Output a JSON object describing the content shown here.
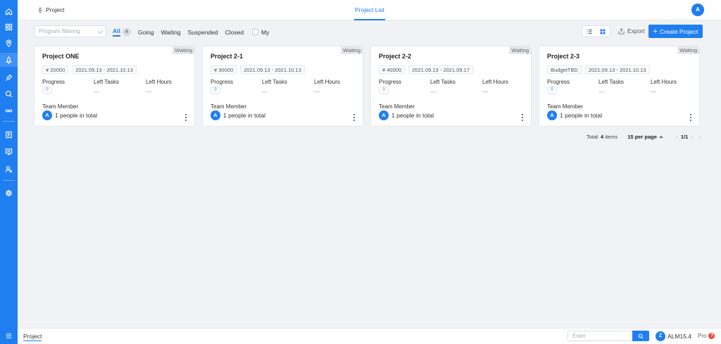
{
  "sidebar": {
    "items": [
      {
        "icon": "home-icon"
      },
      {
        "icon": "dashboard-grid-icon"
      },
      {
        "icon": "location-pin-icon"
      },
      {
        "icon": "rocket-icon",
        "active": true
      },
      {
        "icon": "pin-icon"
      },
      {
        "icon": "search-icon"
      },
      {
        "icon": "infinity-icon"
      },
      {
        "icon": "list-document-icon"
      },
      {
        "icon": "monitor-icon"
      },
      {
        "icon": "user-settings-icon"
      },
      {
        "icon": "gear-icon"
      }
    ],
    "bottom_icon": "menu-icon"
  },
  "header": {
    "breadcrumb": "Project",
    "tab": "Project List",
    "avatar": "A"
  },
  "filters": {
    "search_placeholder": "Program filtering",
    "tabs": [
      {
        "label": "All",
        "count": "4",
        "active": true
      },
      {
        "label": "Going"
      },
      {
        "label": "Waiting"
      },
      {
        "label": "Suspended"
      },
      {
        "label": "Closed"
      }
    ],
    "my_label": "My",
    "export_label": "Export",
    "create_label": "Create Project",
    "create_plus": "+"
  },
  "labels": {
    "progress": "Progress",
    "left_tasks": "Left Tasks",
    "left_hours": "Left Hours",
    "team_member": "Team Member",
    "empty": "—"
  },
  "projects": [
    {
      "title": "Project ONE",
      "status": "Waiting",
      "budget": "¥ 20000",
      "dates": "2021.09.13 - 2021.10.13",
      "progress": "0",
      "left_tasks": "—",
      "left_hours": "—",
      "avatar": "A",
      "members": "1 people in total"
    },
    {
      "title": "Project 2-1",
      "status": "Waiting",
      "budget": "¥ 30000",
      "dates": "2021.09.13 - 2021.10.13",
      "progress": "0",
      "left_tasks": "—",
      "left_hours": "—",
      "avatar": "A",
      "members": "1 people in total"
    },
    {
      "title": "Project 2-2",
      "status": "Waiting",
      "budget": "¥ 40000",
      "dates": "2021.09.13 - 2021.09.17",
      "progress": "0",
      "left_tasks": "—",
      "left_hours": "—",
      "avatar": "A",
      "members": "1 people in total"
    },
    {
      "title": "Project 2-3",
      "status": "Waiting",
      "budget": "BudgetTBD",
      "dates": "2021.09.13 - 2021.10.13",
      "progress": "0",
      "left_tasks": "—",
      "left_hours": "—",
      "avatar": "A",
      "members": "1 people in total"
    }
  ],
  "pagination": {
    "total_prefix": "Total:",
    "total_count": "4",
    "total_suffix": "items",
    "per_page": "15 per page",
    "page": "1/1"
  },
  "footer": {
    "tab": "Project",
    "search_placeholder": "Enter",
    "version": "ALM15.4",
    "logo": "Z",
    "pro": "Pro",
    "help": "?"
  },
  "colors": {
    "primary": "#1f7ff0",
    "sidebar": "#1f7ff0",
    "background": "#f1f2f5"
  }
}
